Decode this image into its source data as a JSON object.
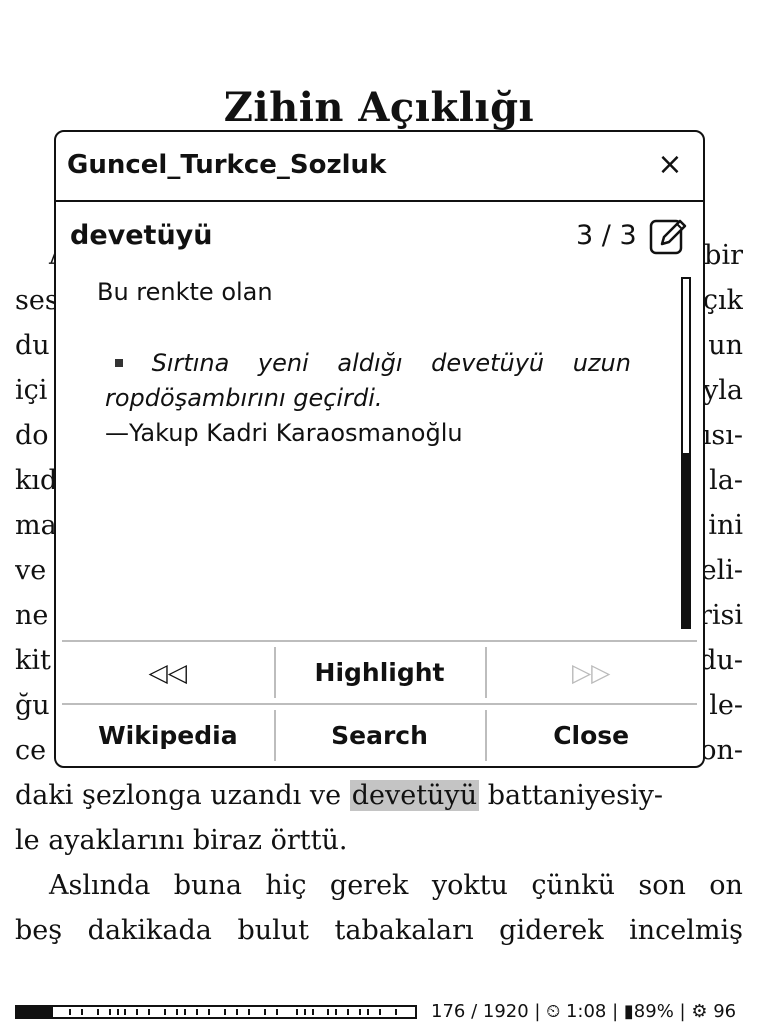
{
  "book": {
    "chapter_title": "Zihin Açıklığı",
    "lines": [
      {
        "left": "A",
        "right": "bir"
      },
      {
        "left": "ses",
        "right": "çık"
      },
      {
        "left": "du",
        "right": "un"
      },
      {
        "left": "içi",
        "right": "yla"
      },
      {
        "left": "do",
        "right": "ısı-"
      },
      {
        "left": "kıd",
        "right": "la-"
      },
      {
        "left": "ma",
        "right": "ini"
      },
      {
        "left": "ve",
        "right": "eli-"
      },
      {
        "left": "ne",
        "right": "risi"
      },
      {
        "left": "kit",
        "right": "du-"
      },
      {
        "left": "ğu",
        "right": "le-"
      },
      {
        "left": "ce",
        "right": "on-"
      }
    ],
    "full_lines": {
      "l13_before": "daki şezlonga uzandı ve",
      "l13_highlight": "devetüyü",
      "l13_after": "battaniyesiy-",
      "l14": "le ayaklarını biraz örttü.",
      "l15": [
        "Aslında",
        "buna",
        "hiç",
        "gerek",
        "yoktu",
        "çünkü",
        "son",
        "on"
      ],
      "l16": [
        "beş",
        "dakikada",
        "bulut",
        "tabakaları",
        "giderek",
        "incelmiş"
      ]
    }
  },
  "dictionary": {
    "name": "Guncel_Turkce_Sozluk",
    "close_symbol": "×",
    "headword": "devetüyü",
    "counter": "3 / 3",
    "edit_icon": "edit-pencil-icon",
    "definition": "Bu renkte olan",
    "example_words": [
      "Sırtına",
      "yeni",
      "aldığı",
      "devetüyü",
      "uzun"
    ],
    "example_line2": "ropdöşambırını geçirdi.",
    "example_author": "—Yakup Kadri Karaosmanoğlu",
    "scroll_fraction": 0.5,
    "buttons": {
      "prev": "◁◁",
      "highlight": "Highlight",
      "next": "▷▷",
      "wikipedia": "Wikipedia",
      "search": "Search",
      "close": "Close"
    }
  },
  "footer": {
    "progress_fraction": 0.09,
    "page": "176 / 1920",
    "time": "⏲ 1:08",
    "battery": "▮89%",
    "settings": "⚙ 96",
    "separator": " | "
  }
}
